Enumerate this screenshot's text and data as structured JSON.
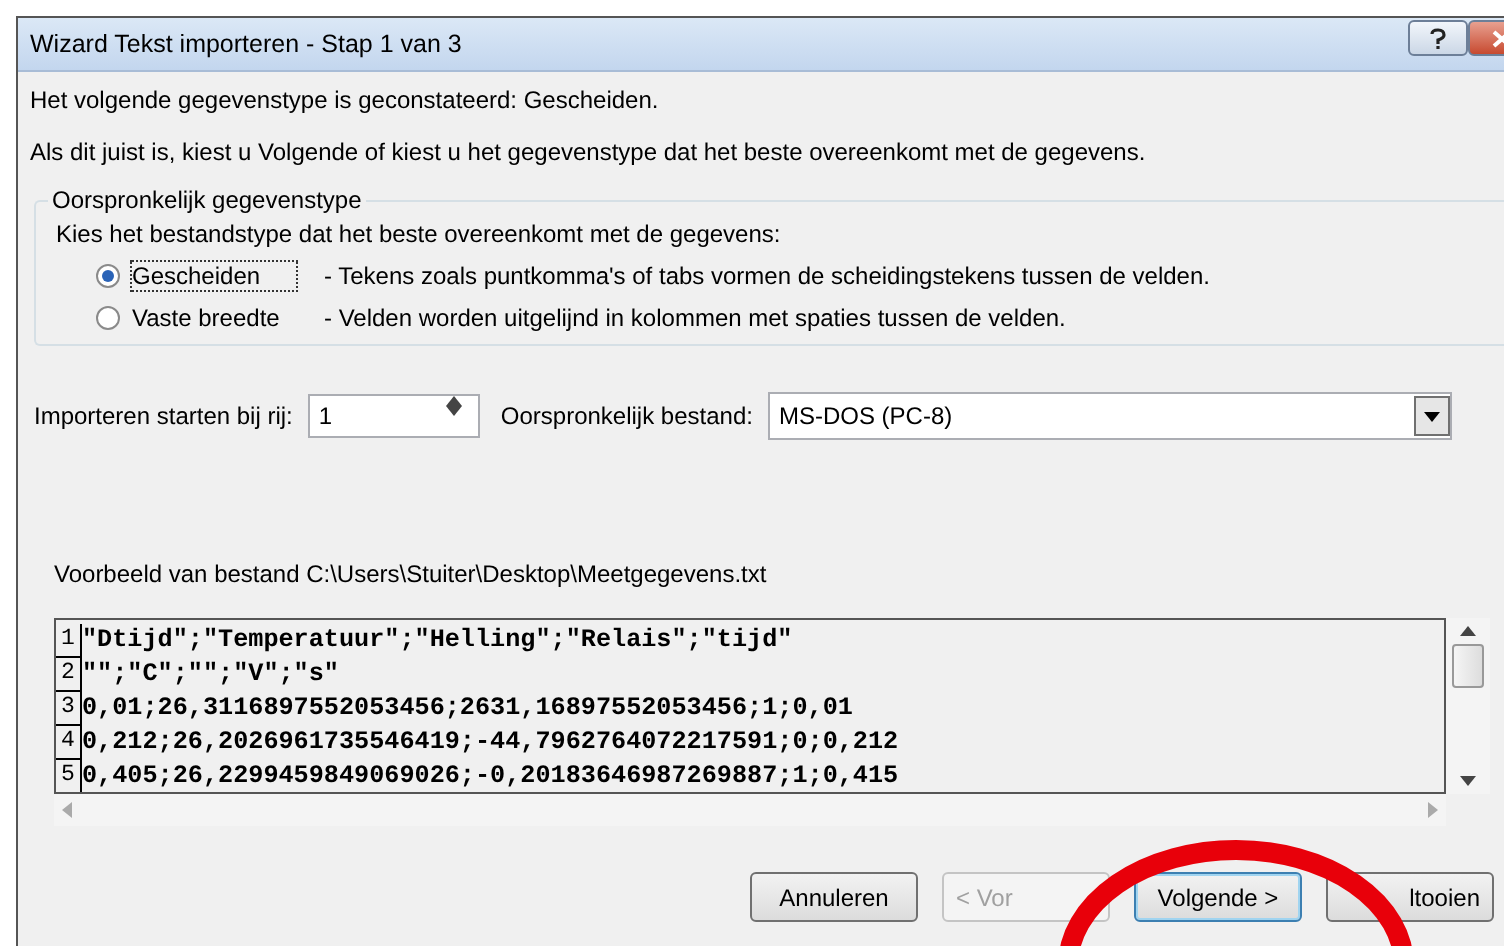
{
  "window": {
    "title": "Wizard Tekst importeren - Stap 1 van 3"
  },
  "detected": "Het volgende gegevenstype is geconstateerd: Gescheiden.",
  "instruction": "Als dit juist is, kiest u Volgende of kiest u het gegevenstype dat het beste overeenkomt met de gegevens.",
  "group": {
    "legend": "Oorspronkelijk gegevenstype",
    "prompt": "Kies het bestandstype dat het beste overeenkomt met de gegevens:",
    "options": [
      {
        "label": "Gescheiden",
        "description": "- Tekens zoals puntkomma's of tabs vormen de scheidingstekens tussen de velden.",
        "selected": true
      },
      {
        "label": "Vaste breedte",
        "description": "- Velden worden uitgelijnd in kolommen met spaties tussen de velden.",
        "selected": false
      }
    ]
  },
  "start_row": {
    "label": "Importeren starten bij rij:",
    "value": "1"
  },
  "origin": {
    "label": "Oorspronkelijk bestand:",
    "value": "MS-DOS (PC-8)"
  },
  "preview": {
    "label": "Voorbeeld van bestand C:\\Users\\Stuiter\\Desktop\\Meetgegevens.txt",
    "lines": [
      {
        "number": "1",
        "text": "\"Dtijd\";\"Temperatuur\";\"Helling\";\"Relais\";\"tijd\""
      },
      {
        "number": "2",
        "text": "\"\";\"C\";\"\";\"V\";\"s\""
      },
      {
        "number": "3",
        "text": "0,01;26,3116897552053456;2631,16897552053456;1;0,01"
      },
      {
        "number": "4",
        "text": "0,212;26,2026961735546419;-44,7962764072217591;0;0,212"
      },
      {
        "number": "5",
        "text": "0,405;26,2299459849069026;-0,20183646987269887;1;0,415"
      }
    ]
  },
  "buttons": [
    {
      "label": "Annuleren",
      "disabled": false,
      "default": false
    },
    {
      "label": "< Vor",
      "disabled": true,
      "default": false
    },
    {
      "label": "Volgende >",
      "disabled": false,
      "default": true
    },
    {
      "label": "ltooien",
      "disabled": false,
      "default": false
    }
  ]
}
